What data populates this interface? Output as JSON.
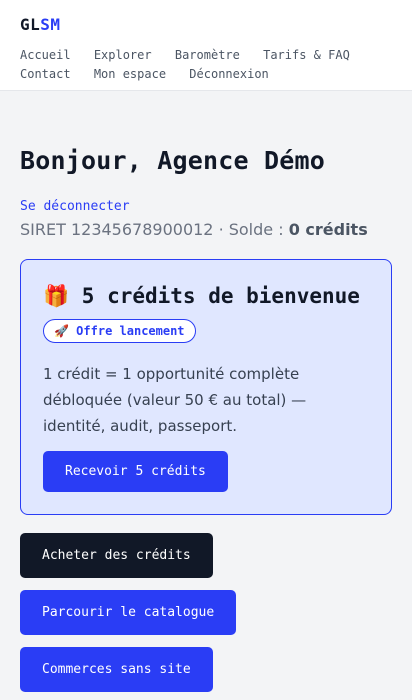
{
  "header": {
    "logo_part1": "GL",
    "logo_part2": "SM",
    "nav": [
      "Accueil",
      "Explorer",
      "Baromètre",
      "Tarifs & FAQ",
      "Contact",
      "Mon espace",
      "Déconnexion"
    ]
  },
  "main": {
    "title": "Bonjour, Agence Démo",
    "logout": "Se déconnecter",
    "siret_line": "SIRET 12345678900012 · Solde : ",
    "credits": "0 crédits"
  },
  "welcome": {
    "title": "🎁 5 crédits de bienvenue",
    "badge": "🚀 Offre lancement",
    "description": "1 crédit = 1 opportunité complète débloquée (valeur 50 € au total) — identité, audit, passeport.",
    "button": "Recevoir 5 crédits"
  },
  "actions": {
    "buy": "Acheter des crédits",
    "catalog": "Parcourir le catalogue",
    "no_site": "Commerces sans site"
  },
  "colors": {
    "accent": "#2a3df5",
    "dark": "#111827",
    "card_bg": "#e0e7ff"
  }
}
